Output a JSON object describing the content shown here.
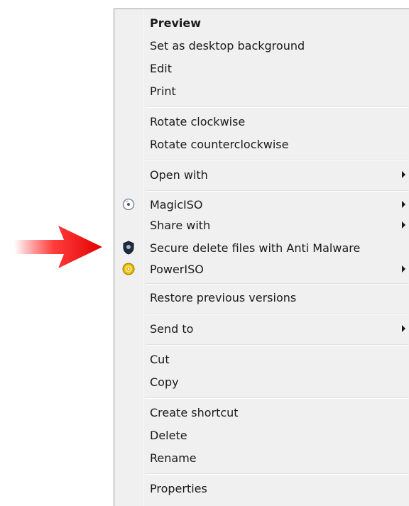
{
  "menu": {
    "items": [
      {
        "label": "Preview"
      },
      {
        "label": "Set as desktop background"
      },
      {
        "label": "Edit"
      },
      {
        "label": "Print"
      },
      {
        "label": "Rotate clockwise"
      },
      {
        "label": "Rotate counterclockwise"
      },
      {
        "label": "Open with"
      },
      {
        "label": "MagicISO"
      },
      {
        "label": "Share with"
      },
      {
        "label": "Secure delete files with Anti Malware"
      },
      {
        "label": "PowerISO"
      },
      {
        "label": "Restore previous versions"
      },
      {
        "label": "Send to"
      },
      {
        "label": "Cut"
      },
      {
        "label": "Copy"
      },
      {
        "label": "Create shortcut"
      },
      {
        "label": "Delete"
      },
      {
        "label": "Rename"
      },
      {
        "label": "Properties"
      }
    ]
  },
  "icons": {
    "magiciso": "magiciso-disc-icon",
    "antimalware": "anti-malware-shield-icon",
    "poweriso": "poweriso-disc-icon",
    "submenu": "chevron-right-icon",
    "pointer": "red-arrow-icon"
  },
  "colors": {
    "menu_background": "#f0f0f0",
    "arrow": "#e00000"
  }
}
